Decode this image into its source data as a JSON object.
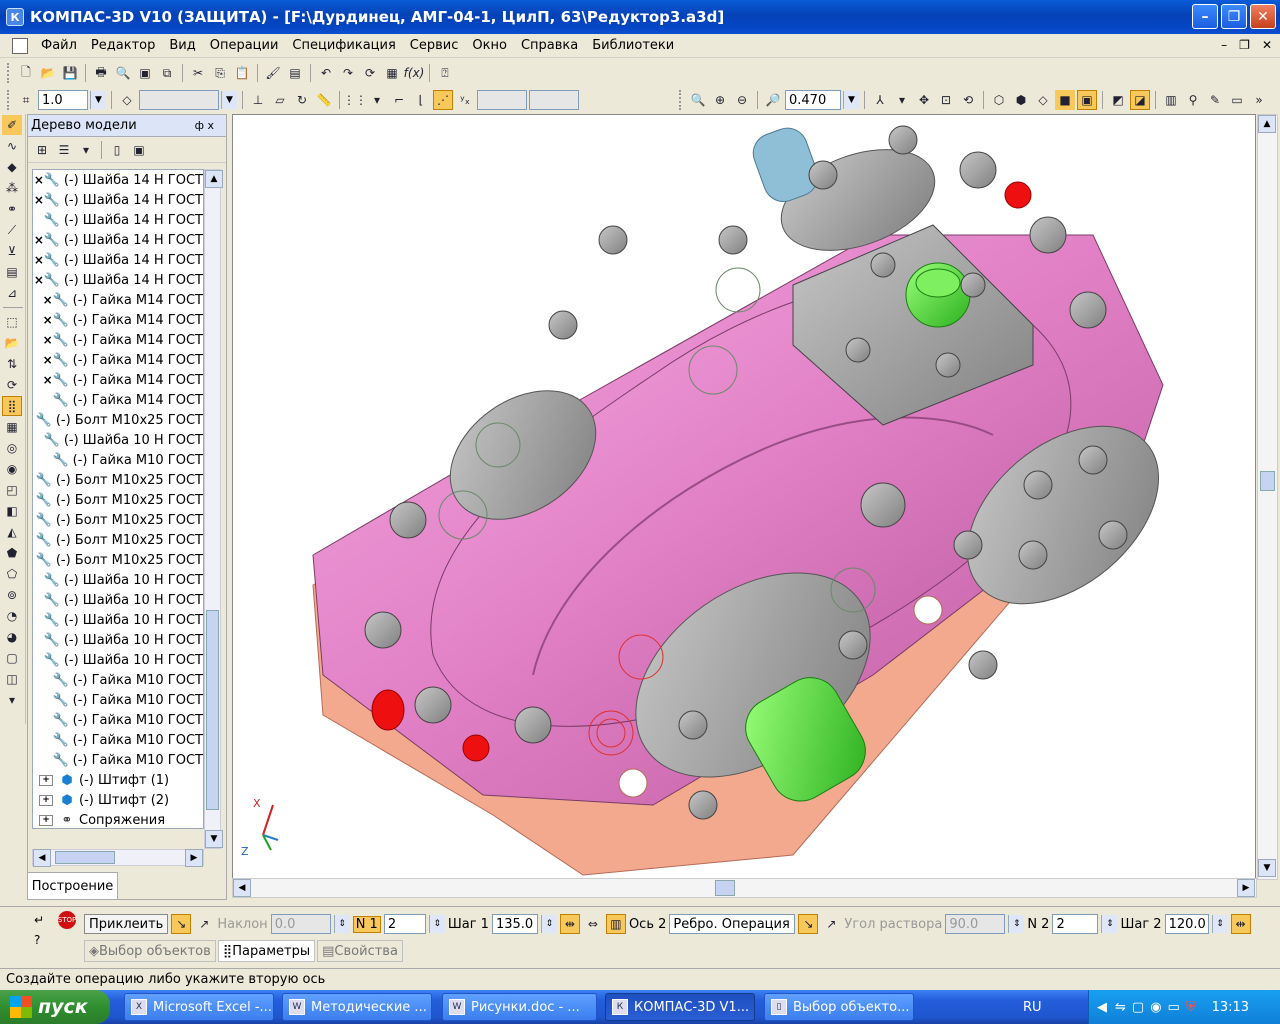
{
  "window": {
    "title": "КОМПАС-3D V10 (ЗАЩИТА) - [F:\\Дурдинец, АМГ-04-1, ЦилП, 63\\Редуктор3.a3d]",
    "icon": "kompas-icon"
  },
  "menu": [
    "Файл",
    "Редактор",
    "Вид",
    "Операции",
    "Спецификация",
    "Сервис",
    "Окно",
    "Справка",
    "Библиотеки"
  ],
  "toolbar2": {
    "step_value": "1.0",
    "zoom_value": "0.470"
  },
  "tree": {
    "title": "Дерево модели",
    "pin": "ф х",
    "items": [
      {
        "mark": "×",
        "text": "(-) Шайба 14 Н ГОСТ",
        "color": "#29a9d8"
      },
      {
        "mark": "×",
        "text": "(-) Шайба 14 Н ГОСТ",
        "color": "#29a9d8"
      },
      {
        "mark": "",
        "text": "(-) Шайба 14 Н ГОСТ",
        "color": "#d0128a"
      },
      {
        "mark": "×",
        "text": "(-) Шайба 14 Н ГОСТ",
        "color": "#29a9d8"
      },
      {
        "mark": "×",
        "text": "(-) Шайба 14 Н ГОСТ",
        "color": "#29a9d8"
      },
      {
        "mark": "×",
        "text": "(-) Шайба 14 Н ГОСТ",
        "color": "#29a9d8"
      },
      {
        "mark": "×",
        "text": "(-) Гайка М14 ГОСТ",
        "color": "#29a9d8"
      },
      {
        "mark": "×",
        "text": "(-) Гайка М14 ГОСТ",
        "color": "#29a9d8"
      },
      {
        "mark": "×",
        "text": "(-) Гайка М14 ГОСТ",
        "color": "#29a9d8"
      },
      {
        "mark": "×",
        "text": "(-) Гайка М14 ГОСТ",
        "color": "#29a9d8"
      },
      {
        "mark": "×",
        "text": "(-) Гайка М14 ГОСТ",
        "color": "#29a9d8"
      },
      {
        "mark": "",
        "text": "(-) Гайка М14 ГОСТ",
        "color": "#d0128a"
      },
      {
        "mark": "",
        "text": "(-) Болт М10х25 ГОСТ",
        "color": "#1a7fd0"
      },
      {
        "mark": "",
        "text": "(-) Шайба 10 Н ГОСТ",
        "color": "#1a7fd0"
      },
      {
        "mark": "",
        "text": "(-) Гайка М10 ГОСТ",
        "color": "#1a7fd0"
      },
      {
        "mark": "",
        "text": "(-) Болт М10х25 ГОСТ",
        "color": "#1a7fd0"
      },
      {
        "mark": "",
        "text": "(-) Болт М10х25 ГОСТ",
        "color": "#1a7fd0"
      },
      {
        "mark": "",
        "text": "(-) Болт М10х25 ГОСТ",
        "color": "#1a7fd0"
      },
      {
        "mark": "",
        "text": "(-) Болт М10х25 ГОСТ",
        "color": "#1a7fd0"
      },
      {
        "mark": "",
        "text": "(-) Болт М10х25 ГОСТ",
        "color": "#1a7fd0"
      },
      {
        "mark": "",
        "text": "(-) Шайба 10 Н ГОСТ",
        "color": "#1a7fd0"
      },
      {
        "mark": "",
        "text": "(-) Шайба 10 Н ГОСТ",
        "color": "#1a7fd0"
      },
      {
        "mark": "",
        "text": "(-) Шайба 10 Н ГОСТ",
        "color": "#1a7fd0"
      },
      {
        "mark": "",
        "text": "(-) Шайба 10 Н ГОСТ",
        "color": "#1a7fd0"
      },
      {
        "mark": "",
        "text": "(-) Шайба 10 Н ГОСТ",
        "color": "#1a7fd0"
      },
      {
        "mark": "",
        "text": "(-) Гайка М10 ГОСТ",
        "color": "#1a7fd0"
      },
      {
        "mark": "",
        "text": "(-) Гайка М10 ГОСТ",
        "color": "#1a7fd0"
      },
      {
        "mark": "",
        "text": "(-) Гайка М10 ГОСТ",
        "color": "#1a7fd0"
      },
      {
        "mark": "",
        "text": "(-) Гайка М10 ГОСТ",
        "color": "#1a7fd0"
      },
      {
        "mark": "",
        "text": "(-) Гайка М10 ГОСТ",
        "color": "#1a7fd0"
      },
      {
        "mark": "+",
        "text": "(-) Штифт (1)",
        "color": "#1a7fd0"
      },
      {
        "mark": "+",
        "text": "(-) Штифт (2)",
        "color": "#1a7fd0"
      },
      {
        "mark": "+",
        "text": "Сопряжения",
        "color": "#333333"
      }
    ],
    "bottom_tab": "Построение"
  },
  "viewport": {
    "axis_x": "X",
    "axis_z": "Z",
    "body_color": "#e98acd",
    "base_color": "#f3a98e",
    "metal_color": "#a9a9a9",
    "shaft_color": "#5ee34a"
  },
  "props": {
    "attach_btn": "Приклеить",
    "tilt_label": "Наклон",
    "tilt_value": "0.0",
    "n1_label": "N 1",
    "n1_value": "2",
    "step1_label": "Шаг 1",
    "step1_value": "135.0",
    "axis2_label": "Ось 2",
    "axis2_value": "Ребро. Операция в",
    "angle_label": "Угол раствора",
    "angle_value": "90.0",
    "n2_label": "N 2",
    "n2_value": "2",
    "step2_label": "Шаг 2",
    "step2_value": "120.0",
    "tabs": [
      "Выбор объектов",
      "Параметры",
      "Свойства"
    ],
    "active_tab": 1
  },
  "status": "Создайте операцию либо укажите вторую ось",
  "taskbar": {
    "start": "пуск",
    "items": [
      "Microsoft Excel -...",
      "Методические ...",
      "Рисунки.doc - ...",
      "КОМПАС-3D V1...",
      "Выбор объекто..."
    ],
    "active": 3,
    "lang": "RU",
    "clock": "13:13"
  }
}
